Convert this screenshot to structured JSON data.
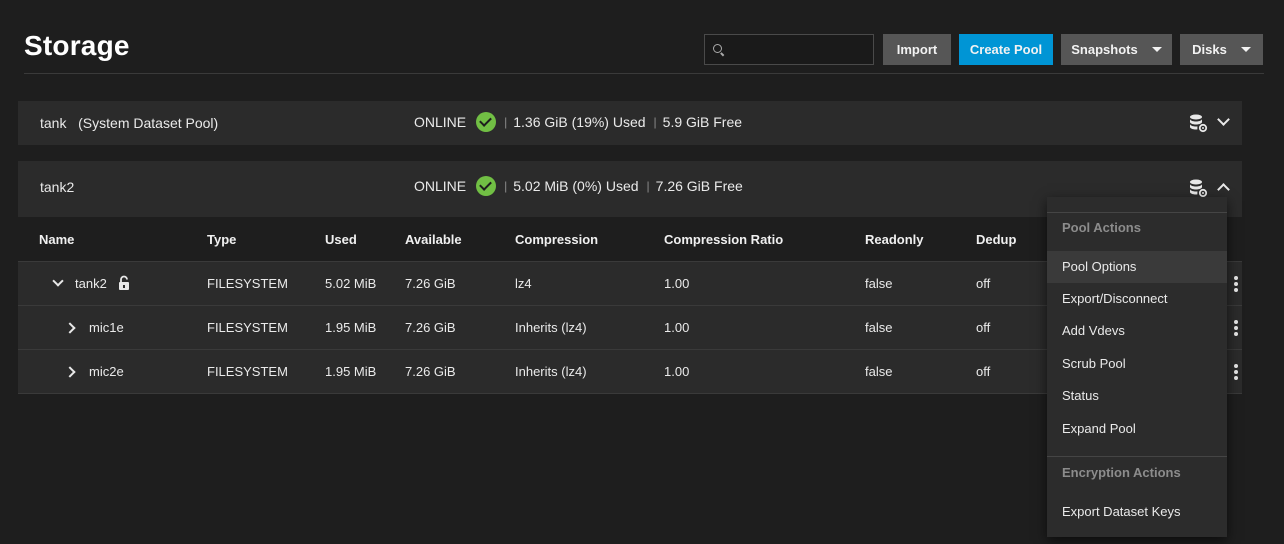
{
  "header": {
    "title": "Storage",
    "search_placeholder": "",
    "buttons": {
      "import": "Import",
      "create_pool": "Create Pool",
      "snapshots": "Snapshots",
      "disks": "Disks"
    }
  },
  "pools": [
    {
      "name": "tank",
      "label": "(System Dataset Pool)",
      "status": "ONLINE",
      "used": "1.36 GiB (19%) Used",
      "free": "5.9 GiB Free"
    },
    {
      "name": "tank2",
      "label": "",
      "status": "ONLINE",
      "used": "5.02 MiB (0%) Used",
      "free": "7.26 GiB Free"
    }
  ],
  "table": {
    "columns": [
      "Name",
      "Type",
      "Used",
      "Available",
      "Compression",
      "Compression Ratio",
      "Readonly",
      "Dedup"
    ],
    "rows": [
      {
        "name": "tank2",
        "type": "FILESYSTEM",
        "used": "5.02 MiB",
        "available": "7.26 GiB",
        "compression": "lz4",
        "ratio": "1.00",
        "readonly": "false",
        "dedup": "off"
      },
      {
        "name": "mic1e",
        "type": "FILESYSTEM",
        "used": "1.95 MiB",
        "available": "7.26 GiB",
        "compression": "Inherits (lz4)",
        "ratio": "1.00",
        "readonly": "false",
        "dedup": "off"
      },
      {
        "name": "mic2e",
        "type": "FILESYSTEM",
        "used": "1.95 MiB",
        "available": "7.26 GiB",
        "compression": "Inherits (lz4)",
        "ratio": "1.00",
        "readonly": "false",
        "dedup": "off"
      }
    ]
  },
  "menu": {
    "pool_actions_header": "Pool Actions",
    "items": [
      "Pool Options",
      "Export/Disconnect",
      "Add Vdevs",
      "Scrub Pool",
      "Status",
      "Expand Pool"
    ],
    "encryption_header": "Encryption Actions",
    "encryption_items": [
      "Export Dataset Keys"
    ]
  },
  "colors": {
    "accent": "#0095d5",
    "online": "#71bf44",
    "background": "#1e1e1e",
    "card": "#2b2b2b"
  }
}
